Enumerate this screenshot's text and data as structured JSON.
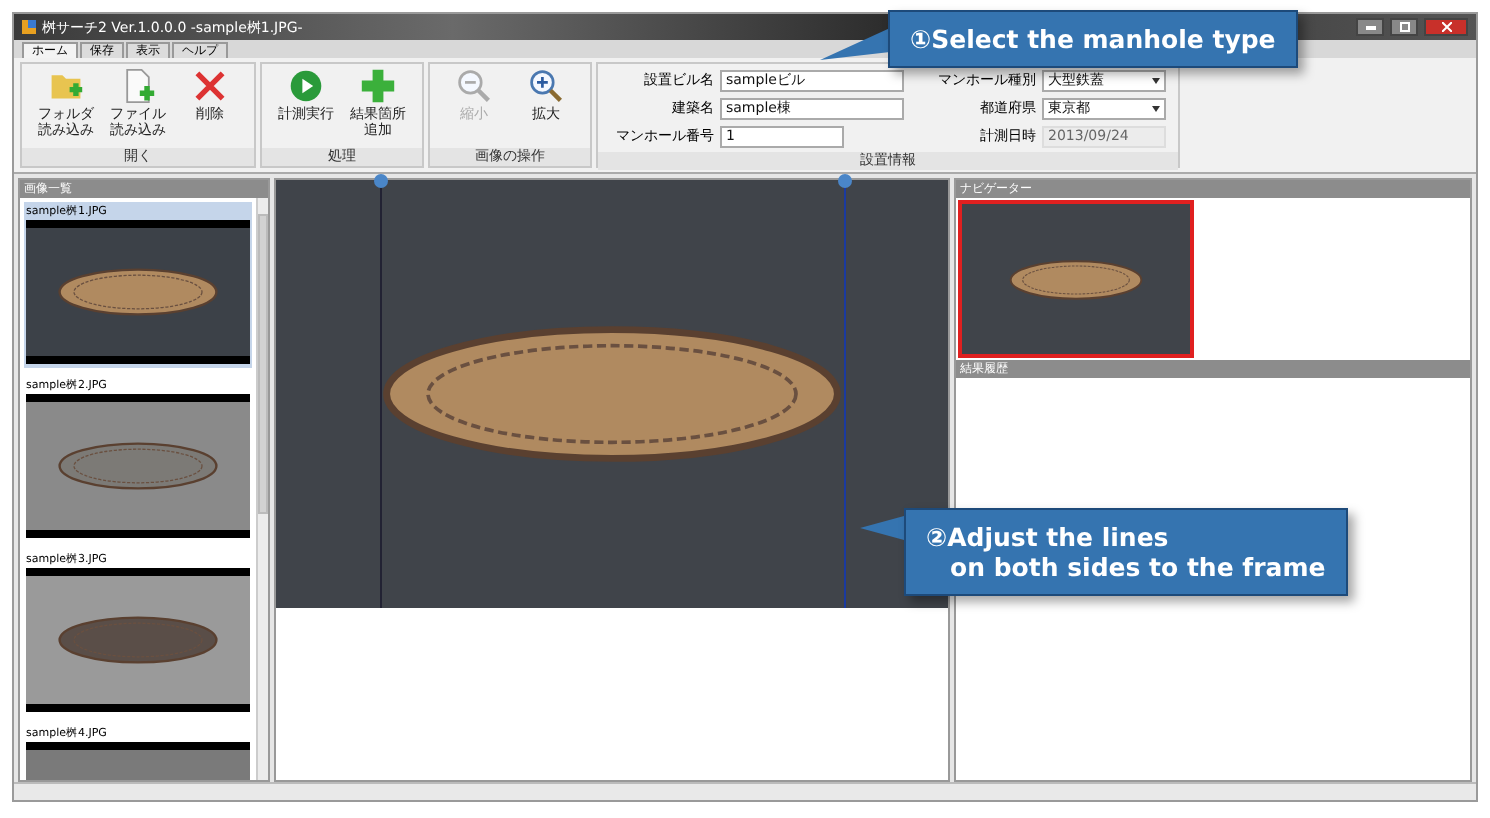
{
  "window": {
    "title": "桝サーチ2 Ver.1.0.0.0 -sample桝1.JPG-"
  },
  "tabs": [
    {
      "label": "ホーム",
      "selected": true
    },
    {
      "label": "保存",
      "selected": false
    },
    {
      "label": "表示",
      "selected": false
    },
    {
      "label": "ヘルプ",
      "selected": false
    }
  ],
  "ribbon": {
    "groups": [
      {
        "label": "開く",
        "buttons": [
          {
            "label": "フォルダ読み込み",
            "kind": "folder-add",
            "disabled": false
          },
          {
            "label": "ファイル読み込み",
            "kind": "file-add",
            "disabled": false
          },
          {
            "label": "削除",
            "kind": "delete",
            "disabled": false
          }
        ]
      },
      {
        "label": "処理",
        "buttons": [
          {
            "label": "計測実行",
            "kind": "play",
            "disabled": false
          },
          {
            "label": "結果箇所追加",
            "kind": "plus",
            "disabled": false
          }
        ]
      },
      {
        "label": "画像の操作",
        "buttons": [
          {
            "label": "縮小",
            "kind": "zoom-out",
            "disabled": true
          },
          {
            "label": "拡大",
            "kind": "zoom-in",
            "disabled": false
          }
        ]
      }
    ],
    "info": {
      "label": "設置情報",
      "columns": [
        [
          {
            "label": "設置ビル名",
            "value": "sampleビル",
            "kind": "text"
          },
          {
            "label": "建築名",
            "value": "sample棟",
            "kind": "text"
          },
          {
            "label": "マンホール番号",
            "value": "1",
            "kind": "short"
          }
        ],
        [
          {
            "label": "マンホール種別",
            "value": "大型鉄蓋",
            "kind": "select"
          },
          {
            "label": "都道府県",
            "value": "東京都",
            "kind": "select"
          },
          {
            "label": "計測日時",
            "value": "2013/09/24",
            "kind": "readonly"
          }
        ]
      ]
    }
  },
  "image_list": {
    "title": "画像一覧",
    "items": [
      {
        "name": "sample桝1.JPG",
        "selected": true
      },
      {
        "name": "sample桝2.JPG",
        "selected": false
      },
      {
        "name": "sample桝3.JPG",
        "selected": false
      },
      {
        "name": "sample桝4.JPG",
        "selected": false
      }
    ]
  },
  "navigator": {
    "title": "ナビゲーター"
  },
  "results": {
    "title": "結果履歴"
  },
  "callouts": [
    {
      "lines": [
        "①Select the manhole type"
      ]
    },
    {
      "lines": [
        "②Adjust the lines",
        "on both sides to the frame"
      ]
    }
  ]
}
